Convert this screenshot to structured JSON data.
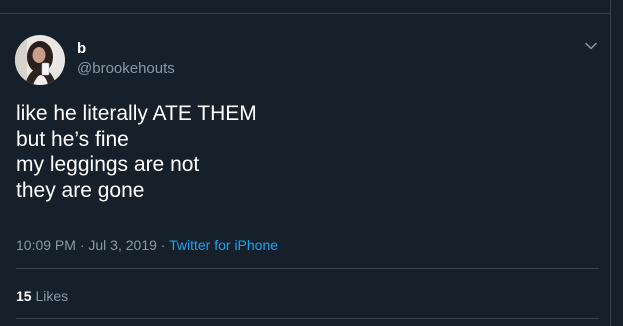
{
  "author": {
    "display_name": "b",
    "handle": "@brookehouts"
  },
  "tweet": {
    "lines": [
      "like he literally ATE THEM",
      "but he’s fine",
      "my leggings are not",
      "they are gone"
    ],
    "time": "10:09 PM",
    "date": "Jul 3, 2019",
    "separator": "·",
    "source": "Twitter for iPhone"
  },
  "stats": {
    "likes_count": "15",
    "likes_label": "Likes"
  },
  "icons": {
    "menu": "chevron-down-icon",
    "avatar": "avatar-photo"
  },
  "colors": {
    "background": "#15202b",
    "text_primary": "#ffffff",
    "text_secondary": "#8899a6",
    "link": "#1da1f2",
    "divider": "#38444d"
  }
}
